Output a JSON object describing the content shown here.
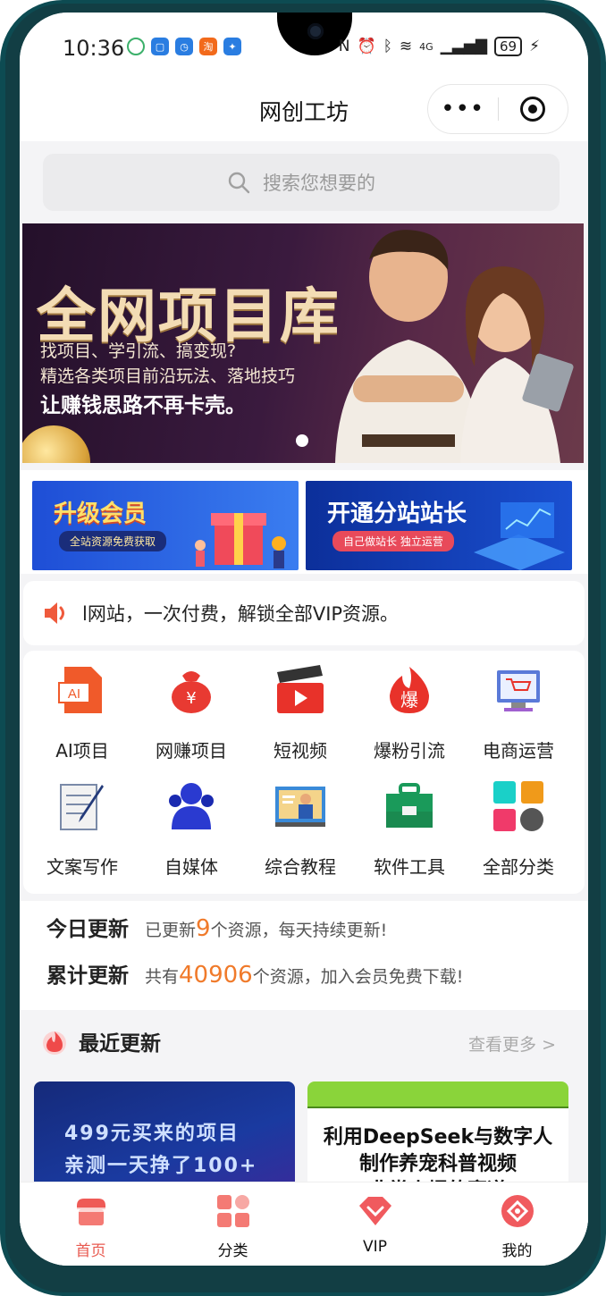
{
  "status_bar": {
    "time": "10:36",
    "battery": "69",
    "network": "4G"
  },
  "nav": {
    "title": "网创工坊",
    "more_label": "•••"
  },
  "search": {
    "placeholder": "搜索您想要的"
  },
  "banner": {
    "title": "全网项目库",
    "line1": "找项目、学引流、搞变现?",
    "line2": "精选各类项目前沿玩法、落地技巧",
    "line3": "让赚钱思路不再卡壳。"
  },
  "promos": [
    {
      "title": "升级会员",
      "subtitle": "全站资源免费获取"
    },
    {
      "title": "开通分站站长",
      "subtitle": "自己做站长 独立运营"
    }
  ],
  "notice": {
    "text": "l网站，一次付费，解锁全部VIP资源。"
  },
  "categories": [
    {
      "label": "AI项目",
      "icon": "ai-file-icon"
    },
    {
      "label": "网赚项目",
      "icon": "money-bag-icon"
    },
    {
      "label": "短视频",
      "icon": "clapperboard-icon"
    },
    {
      "label": "爆粉引流",
      "icon": "fire-icon"
    },
    {
      "label": "电商运营",
      "icon": "shopping-cart-monitor-icon"
    },
    {
      "label": "文案写作",
      "icon": "document-pen-icon"
    },
    {
      "label": "自媒体",
      "icon": "people-icon"
    },
    {
      "label": "综合教程",
      "icon": "tutorial-screen-icon"
    },
    {
      "label": "软件工具",
      "icon": "toolbox-icon"
    },
    {
      "label": "全部分类",
      "icon": "grid-icon"
    }
  ],
  "stats": {
    "today_label": "今日更新",
    "today_prefix": "已更新",
    "today_count": "9",
    "today_suffix": "个资源，每天持续更新!",
    "total_label": "累计更新",
    "total_prefix": "共有",
    "total_count": "40906",
    "total_suffix": "个资源，加入会员免费下载!"
  },
  "recent": {
    "title": "最近更新",
    "more": "查看更多 >",
    "cards": [
      {
        "line1": "499元买来的项目",
        "line2": "亲测一天挣了100+"
      },
      {
        "line1": "利用DeepSeek与数字人",
        "line2": "制作养宠科普视频",
        "line3": "非常火爆的赛道"
      }
    ]
  },
  "tabbar": [
    {
      "label": "首页",
      "icon": "home-store-icon"
    },
    {
      "label": "分类",
      "icon": "category-grid-icon"
    },
    {
      "label": "VIP",
      "icon": "vip-diamond-icon"
    },
    {
      "label": "我的",
      "icon": "profile-icon"
    }
  ],
  "colors": {
    "accent": "#e85a50",
    "highlight": "#f07a2a",
    "promo_blue": "#1b4fd8"
  }
}
